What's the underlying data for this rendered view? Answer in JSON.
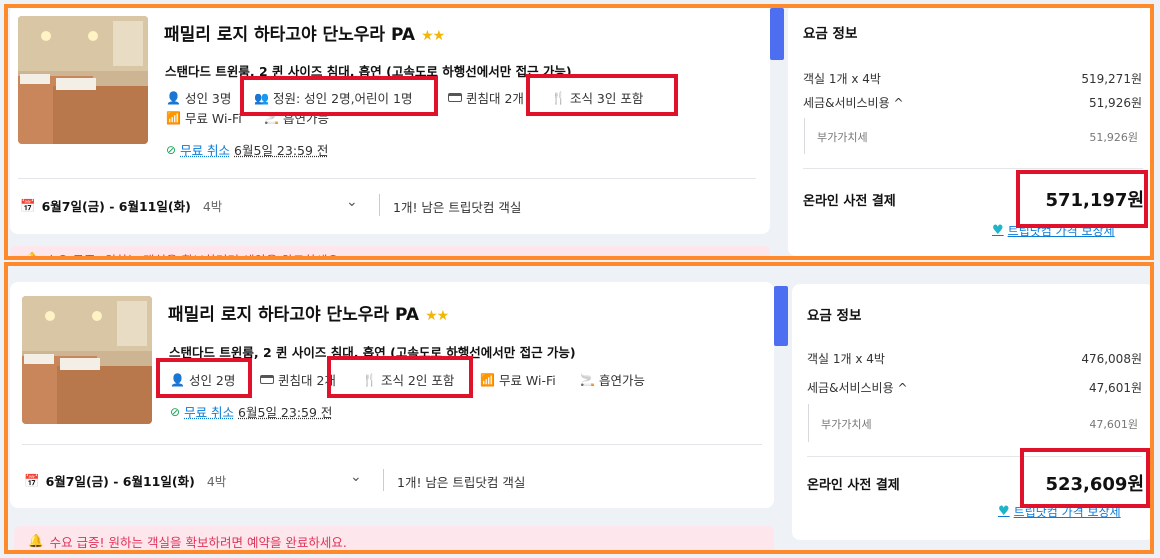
{
  "offers": [
    {
      "hotel_name": "패밀리 로지 하타고야 단노우라 PA",
      "stars": "★★",
      "room_desc": "스탠다드 트윈룸, 2 퀸 사이즈 침대, 흡연 (고속도로 하행선에서만 접근 가능)",
      "features": {
        "adults": "성인 3명",
        "capacity": "정원: 성인 2명,어린이 1명",
        "beds": "퀸침대 2개",
        "breakfast": "조식 3인 포함",
        "wifi": "무료 Wi-Fi",
        "smoking": "흡연가능"
      },
      "free_cancel": "무료 취소",
      "cancel_deadline": "6월5일 23:59 전",
      "dates": "6월7일(금) - 6월11일(화)",
      "nights": "4박",
      "rooms_left": "1개! 남은 트립닷컴 객실",
      "alert": "수요 급증! 원하는 객실을 확보하려면 예약을 완료하세요.",
      "price": {
        "title": "요금 정보",
        "room_label": "객실 1개 x 4박",
        "room_value": "519,271원",
        "tax_label": "세금&서비스비용 ^",
        "tax_value": "51,926원",
        "vat_label": "부가가치세",
        "vat_value": "51,926원",
        "pay_label": "온라인 사전 결제",
        "total": "571,197원",
        "guarantee": "트립닷컴 가격 보장제"
      }
    },
    {
      "hotel_name": "패밀리 로지 하타고야 단노우라 PA",
      "stars": "★★",
      "room_desc": "스탠다드 트윈룸, 2 퀸 사이즈 침대, 흡연 (고속도로 하행선에서만 접근 가능)",
      "features": {
        "adults": "성인 2명",
        "beds": "퀸침대 2개",
        "breakfast": "조식 2인 포함",
        "wifi": "무료 Wi-Fi",
        "smoking": "흡연가능"
      },
      "free_cancel": "무료 취소",
      "cancel_deadline": "6월5일 23:59 전",
      "dates": "6월7일(금) - 6월11일(화)",
      "nights": "4박",
      "rooms_left": "1개! 남은 트립닷컴 객실",
      "alert": "수요 급증! 원하는 객실을 확보하려면 예약을 완료하세요.",
      "price": {
        "title": "요금 정보",
        "room_label": "객실 1개 x 4박",
        "room_value": "476,008원",
        "tax_label": "세금&서비스비용 ^",
        "tax_value": "47,601원",
        "vat_label": "부가가치세",
        "vat_value": "47,601원",
        "pay_label": "온라인 사전 결제",
        "total": "523,609원",
        "guarantee": "트립닷컴 가격 보장제"
      }
    }
  ],
  "colors": {
    "annotation_orange": "#ff8a2b",
    "annotation_red": "#e0112b",
    "accent_blue": "#4e6ef2",
    "alert_pink": "#e0345a"
  }
}
